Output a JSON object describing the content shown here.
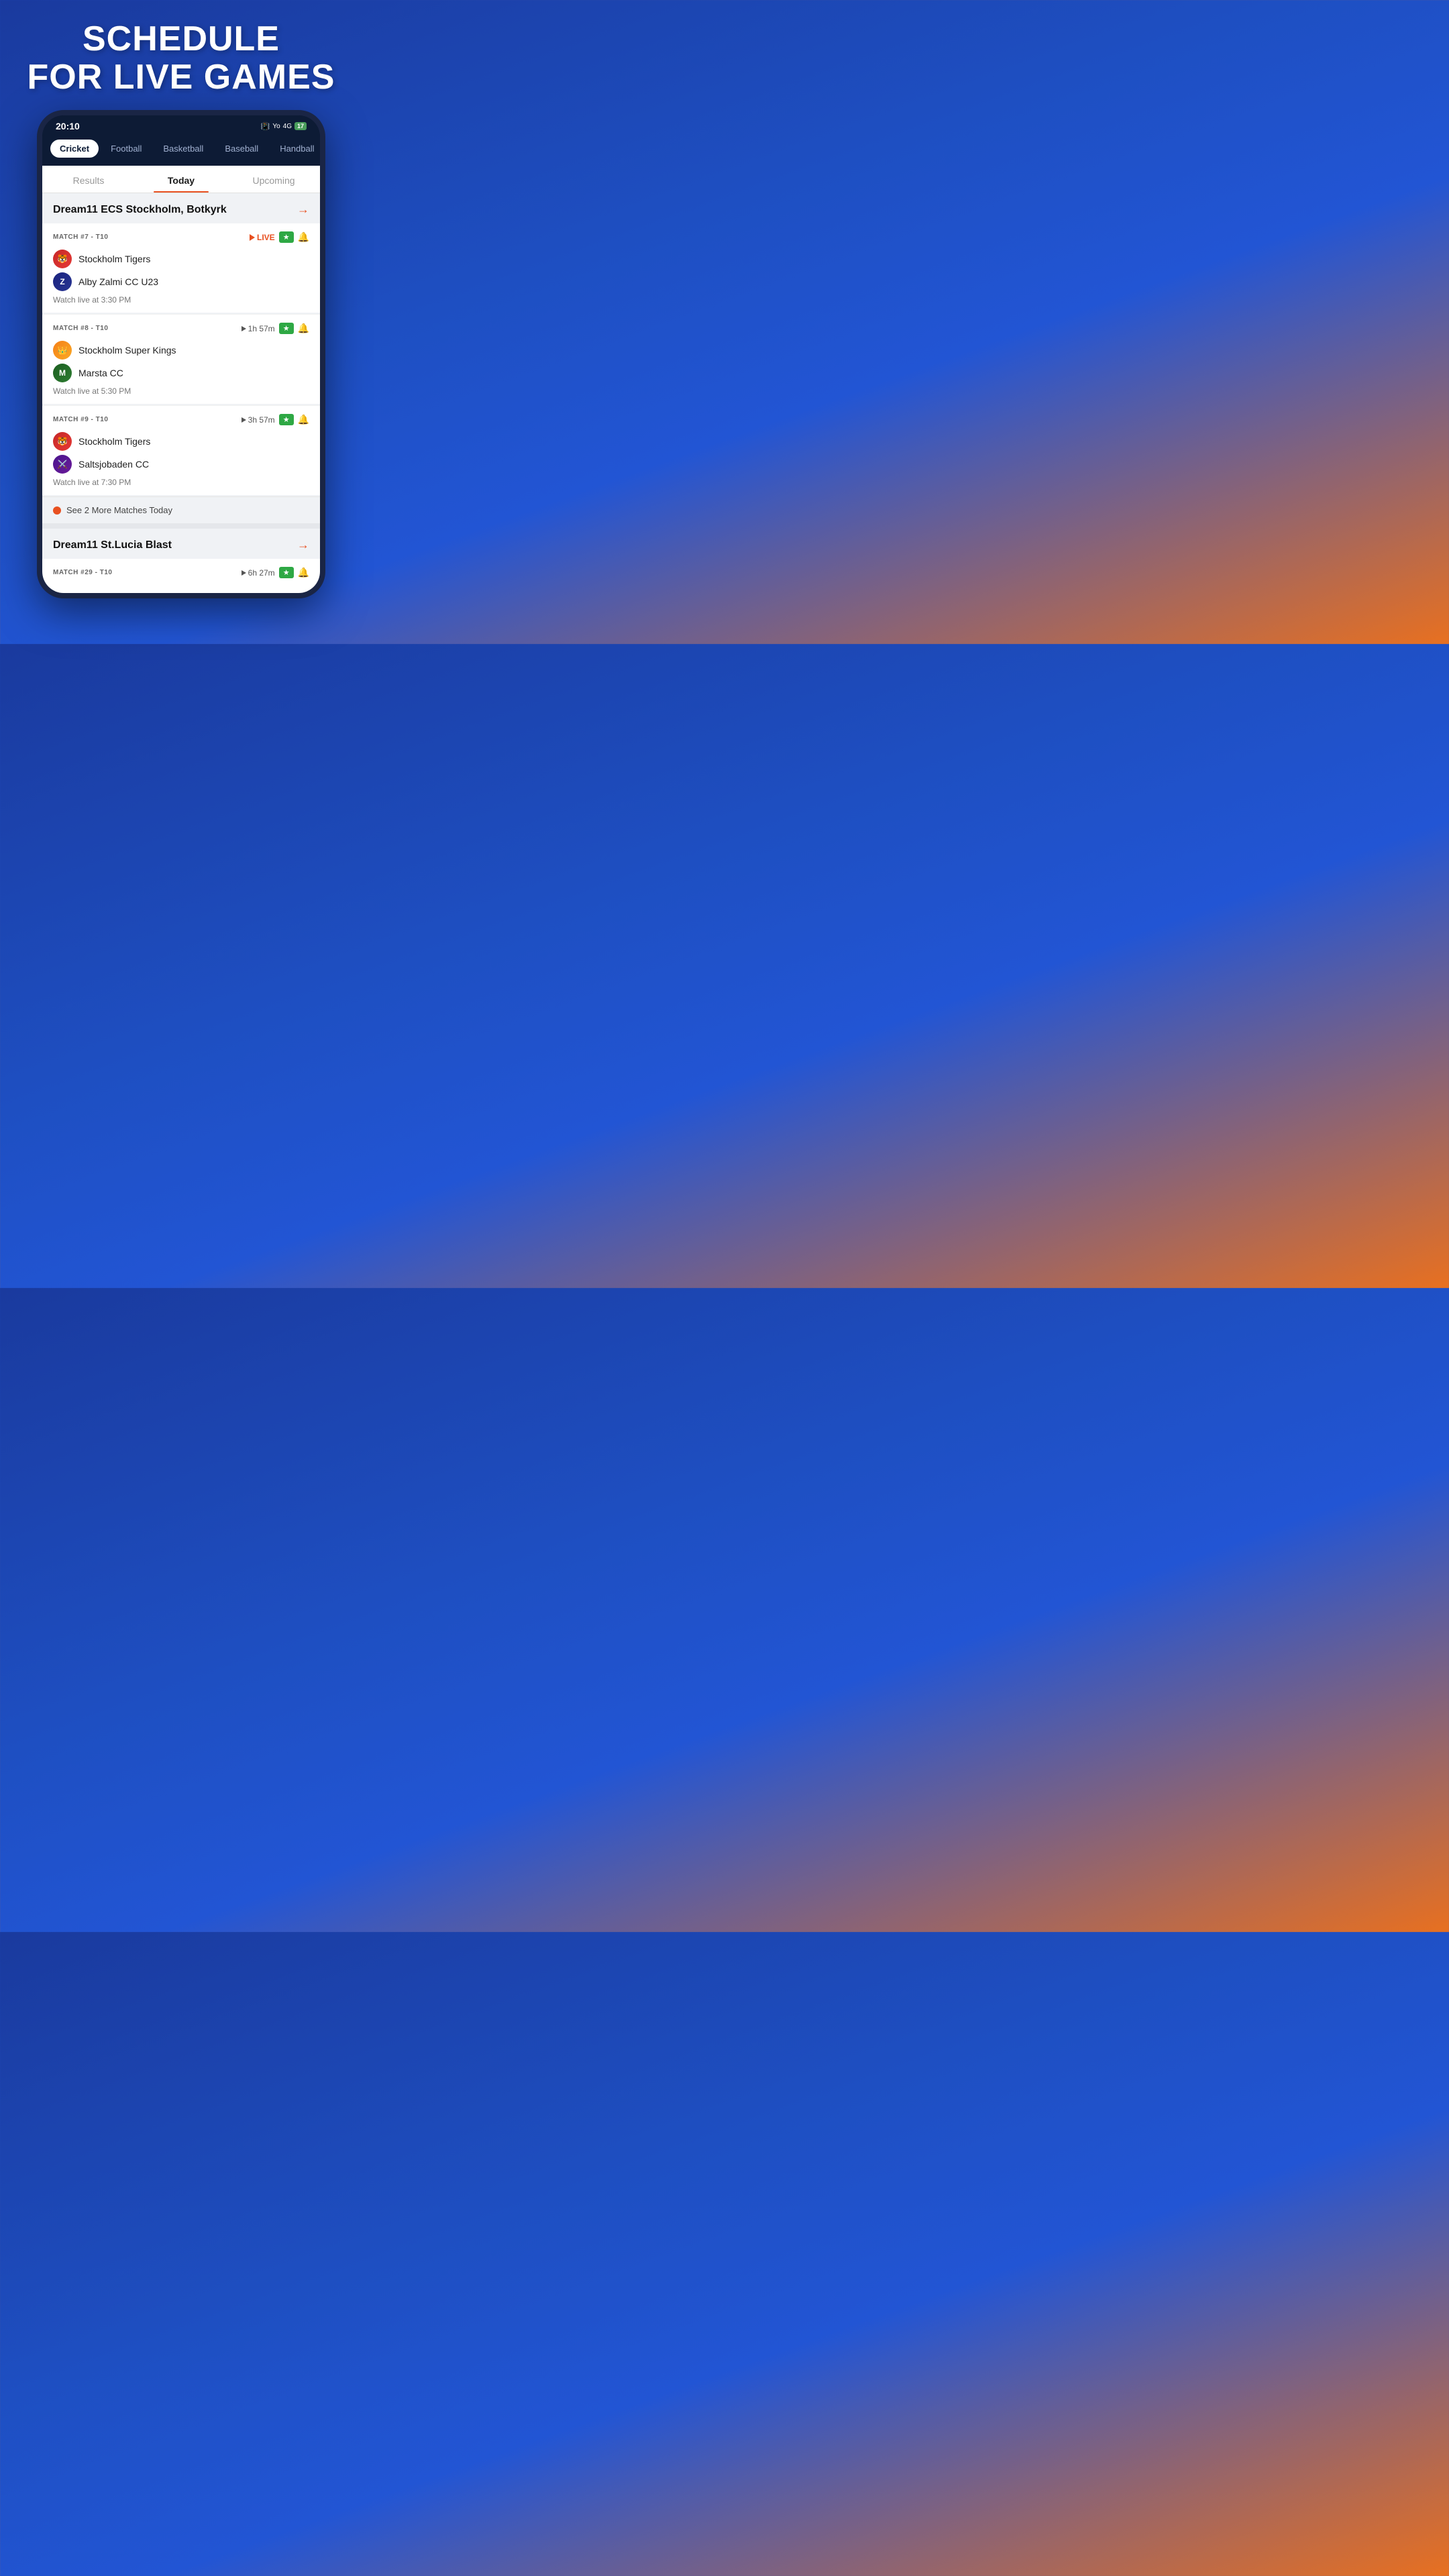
{
  "hero": {
    "line1": "SCHEDULE",
    "line2": "FOR LIVE GAMES"
  },
  "statusBar": {
    "time": "20:10",
    "battery": "17"
  },
  "sportTabs": [
    {
      "label": "Cricket",
      "active": true
    },
    {
      "label": "Football",
      "active": false
    },
    {
      "label": "Basketball",
      "active": false
    },
    {
      "label": "Baseball",
      "active": false
    },
    {
      "label": "Handball",
      "active": false
    }
  ],
  "subTabs": [
    {
      "label": "Results",
      "active": false
    },
    {
      "label": "Today",
      "active": true
    },
    {
      "label": "Upcoming",
      "active": false
    }
  ],
  "section1": {
    "title": "Dream11 ECS Stockholm, Botkyrk",
    "matches": [
      {
        "label": "MATCH #7 - T10",
        "status": "LIVE",
        "isLive": true,
        "team1": "Stockholm Tigers",
        "team1Key": "tigers",
        "team2": "Alby Zalmi CC U23",
        "team2Key": "zalmi",
        "watchTime": "Watch live at 3:30 PM"
      },
      {
        "label": "MATCH #8 - T10",
        "status": "1h 57m",
        "isLive": false,
        "team1": "Stockholm Super Kings",
        "team1Key": "superkings",
        "team2": "Marsta CC",
        "team2Key": "marsta",
        "watchTime": "Watch live at 5:30 PM"
      },
      {
        "label": "MATCH #9 - T10",
        "status": "3h 57m",
        "isLive": false,
        "team1": "Stockholm Tigers",
        "team1Key": "tigers",
        "team2": "Saltsjobaden CC",
        "team2Key": "saltsjobaden",
        "watchTime": "Watch live at 7:30 PM"
      }
    ]
  },
  "seeMore": {
    "text": "See 2 More Matches Today"
  },
  "section2": {
    "title": "Dream11 St.Lucia Blast",
    "matches": [
      {
        "label": "MATCH #29 - T10",
        "status": "6h 27m",
        "isLive": false,
        "team1": "",
        "team2": ""
      }
    ]
  }
}
